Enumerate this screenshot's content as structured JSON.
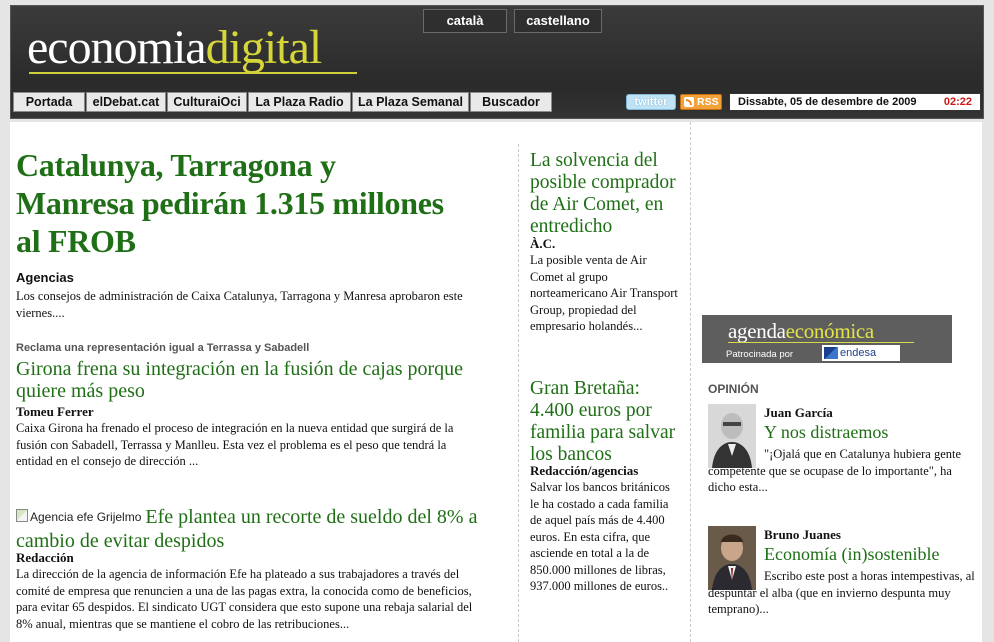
{
  "header": {
    "languages": [
      "català",
      "castellano"
    ],
    "logo": {
      "part1": "economia",
      "part2": "digital"
    },
    "nav": [
      "Portada",
      "elDebat.cat",
      "CulturaiOci",
      "La Plaza Radio",
      "La Plaza Semanal",
      "Buscador"
    ],
    "twitter_label": "twitter",
    "rss_label": "RSS",
    "date": "Dissabte, 05 de desembre de 2009",
    "time": "02:22"
  },
  "main_story": {
    "title": "Catalunya, Tarragona y Manresa pedirán 1.315 millones al FROB",
    "author": "Agencias",
    "summary": "Los consejos de administración de Caixa Catalunya, Tarragona y Manresa aprobaron este viernes...."
  },
  "story2": {
    "kicker": "Reclama una representación igual a Terrassa y Sabadell",
    "title": "Girona frena su integración en la fusión de cajas porque quiere más peso",
    "author": "Tomeu Ferrer",
    "summary": "Caixa Girona ha frenado el proceso de integración en la nueva entidad que surgirá de la fusión con Sabadell, Terrassa y Manlleu. Esta vez el problema es el peso que tendrá la entidad en el consejo de dirección ..."
  },
  "story3": {
    "image_alt": "Agencia efe Grijelmo",
    "title": "Efe plantea un recorte de sueldo del 8% a cambio de evitar despidos",
    "author": "Redacción",
    "summary": "La dirección de la agencia de información Efe ha plateado a sus trabajadores a través del comité de empresa que renuncien a una de las pagas extra, la conocida como de beneficios, para evitar 65 despidos. El sindicato UGT considera que esto supone una rebaja salarial del 8% anual, mientras que se mantiene el cobro de las retribuciones..."
  },
  "mid": [
    {
      "title": "La solvencia del posible comprador de Air Comet, en entredicho",
      "author": "À.C.",
      "summary": "La posible venta de Air Comet al grupo norteamericano Air Transport Group, propiedad del empresario holandés..."
    },
    {
      "title": "Gran Bretaña: 4.400 euros por familia para salvar los bancos",
      "author": "Redacción/agencias",
      "summary": "Salvar los bancos británicos le ha costado a cada familia de aquel país más de 4.400 euros. En esta cifra, que asciende en total a la de 850.000 millones de libras, 937.000 millones de euros.."
    }
  ],
  "agenda": {
    "part1": "agenda",
    "part2": "económica",
    "sponsor_label": "Patrocinada por",
    "sponsor": "endesa"
  },
  "opinion": {
    "label": "OPINIÓN",
    "items": [
      {
        "name": "Juan García",
        "title": "Y nos distraemos",
        "text": "\"¡Ojalá que en Catalunya hubiera gente competente que se ocupase de lo importante\", ha dicho esta..."
      },
      {
        "name": "Bruno Juanes",
        "title": "Economía (in)sostenible",
        "text": "Escribo este post a horas intempestivas, al despuntar el alba (que en invierno despunta muy temprano)..."
      }
    ]
  },
  "colors": {
    "headline": "#1f6f16",
    "accent": "#d6d63a",
    "time": "#cc1a1a"
  }
}
